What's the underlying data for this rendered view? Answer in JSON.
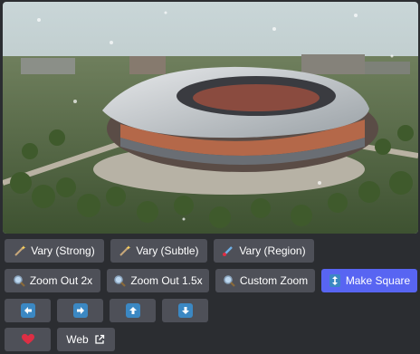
{
  "image": {
    "alt_icon": "stadium-render-image"
  },
  "row1": {
    "vary_strong": "Vary (Strong)",
    "vary_subtle": "Vary (Subtle)",
    "vary_region": "Vary (Region)"
  },
  "row2": {
    "zoom_out_2x": "Zoom Out 2x",
    "zoom_out_1_5x": "Zoom Out 1.5x",
    "custom_zoom": "Custom Zoom",
    "make_square": "Make Square"
  },
  "row3": {
    "icons": [
      "arrow-left-icon",
      "arrow-right-icon",
      "arrow-up-icon",
      "arrow-down-icon"
    ]
  },
  "row4": {
    "favorite_icon": "heart-icon",
    "web": "Web"
  },
  "colors": {
    "background": "#2b2d31",
    "button": "#4e5058",
    "primary_button": "#5865f2",
    "arrow_emoji": "#3b88c3",
    "heart": "#dd2e44"
  }
}
